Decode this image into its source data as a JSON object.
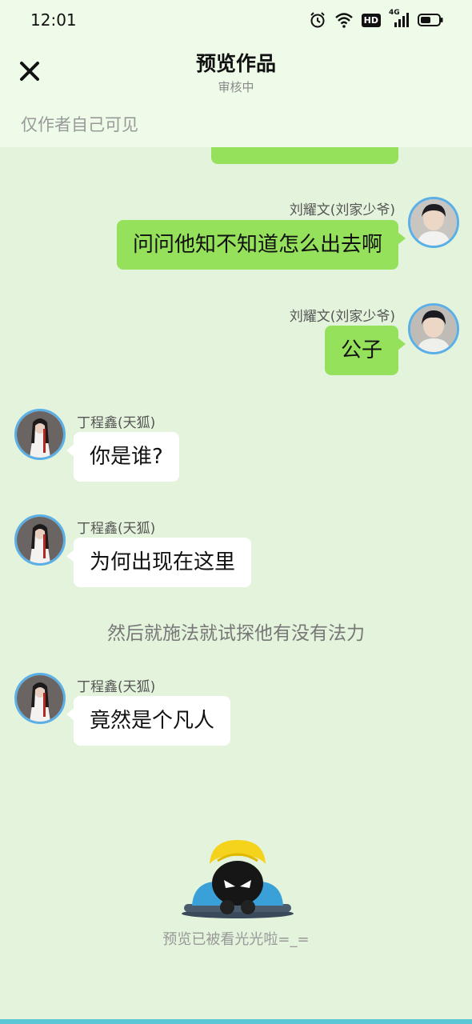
{
  "status": {
    "time": "12:01",
    "network": "4G",
    "hd": "HD"
  },
  "header": {
    "title": "预览作品",
    "subtitle": "审核中",
    "visibility": "仅作者自己可见"
  },
  "messages": [
    {
      "side": "right",
      "name": "刘耀文(刘家少爷)",
      "text": "问问他知不知道怎么出去啊"
    },
    {
      "side": "right",
      "name": "刘耀文(刘家少爷)",
      "text": "公子"
    },
    {
      "side": "left",
      "name": "丁程鑫(天狐)",
      "text": "你是谁?"
    },
    {
      "side": "left",
      "name": "丁程鑫(天狐)",
      "text": "为何出现在这里"
    },
    {
      "side": "left",
      "name": "丁程鑫(天狐)",
      "text": "竟然是个凡人"
    }
  ],
  "narration": "然后就施法就试探他有没有法力",
  "footer": {
    "end_text": "预览已被看光光啦=_="
  },
  "colors": {
    "background": "#e3f3dc",
    "right_bubble": "#95e15b",
    "left_bubble": "#ffffff",
    "avatar_ring": "#5ab0e6"
  }
}
